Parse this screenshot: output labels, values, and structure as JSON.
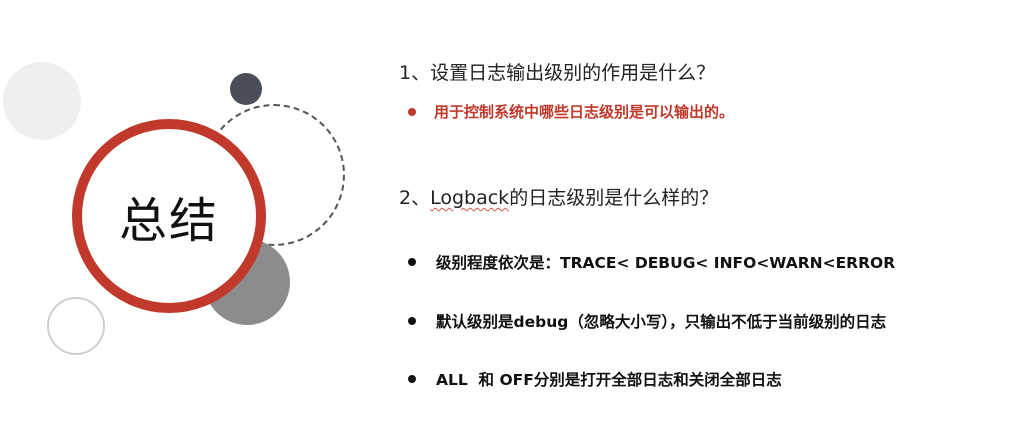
{
  "title": "总结",
  "question1": "1、设置日志输出级别的作用是什么？",
  "answer1": "用于控制系统中哪些日志级别是可以输出的。",
  "question2": {
    "prefix": "2、",
    "underlined": "Logback",
    "suffix": "的日志级别是什么样的？"
  },
  "bullets": [
    "级别程度依次是：TRACE< DEBUG< INFO<WARN<ERROR",
    "默认级别是debug（忽略大小写），只输出不低于当前级别的日志",
    "ALL  和 OFF分别是打开全部日志和关闭全部日志"
  ],
  "colors": {
    "accent": "#c0392b",
    "dark_circle": "#4a4f57",
    "gray_circle": "#8c8c8c"
  }
}
